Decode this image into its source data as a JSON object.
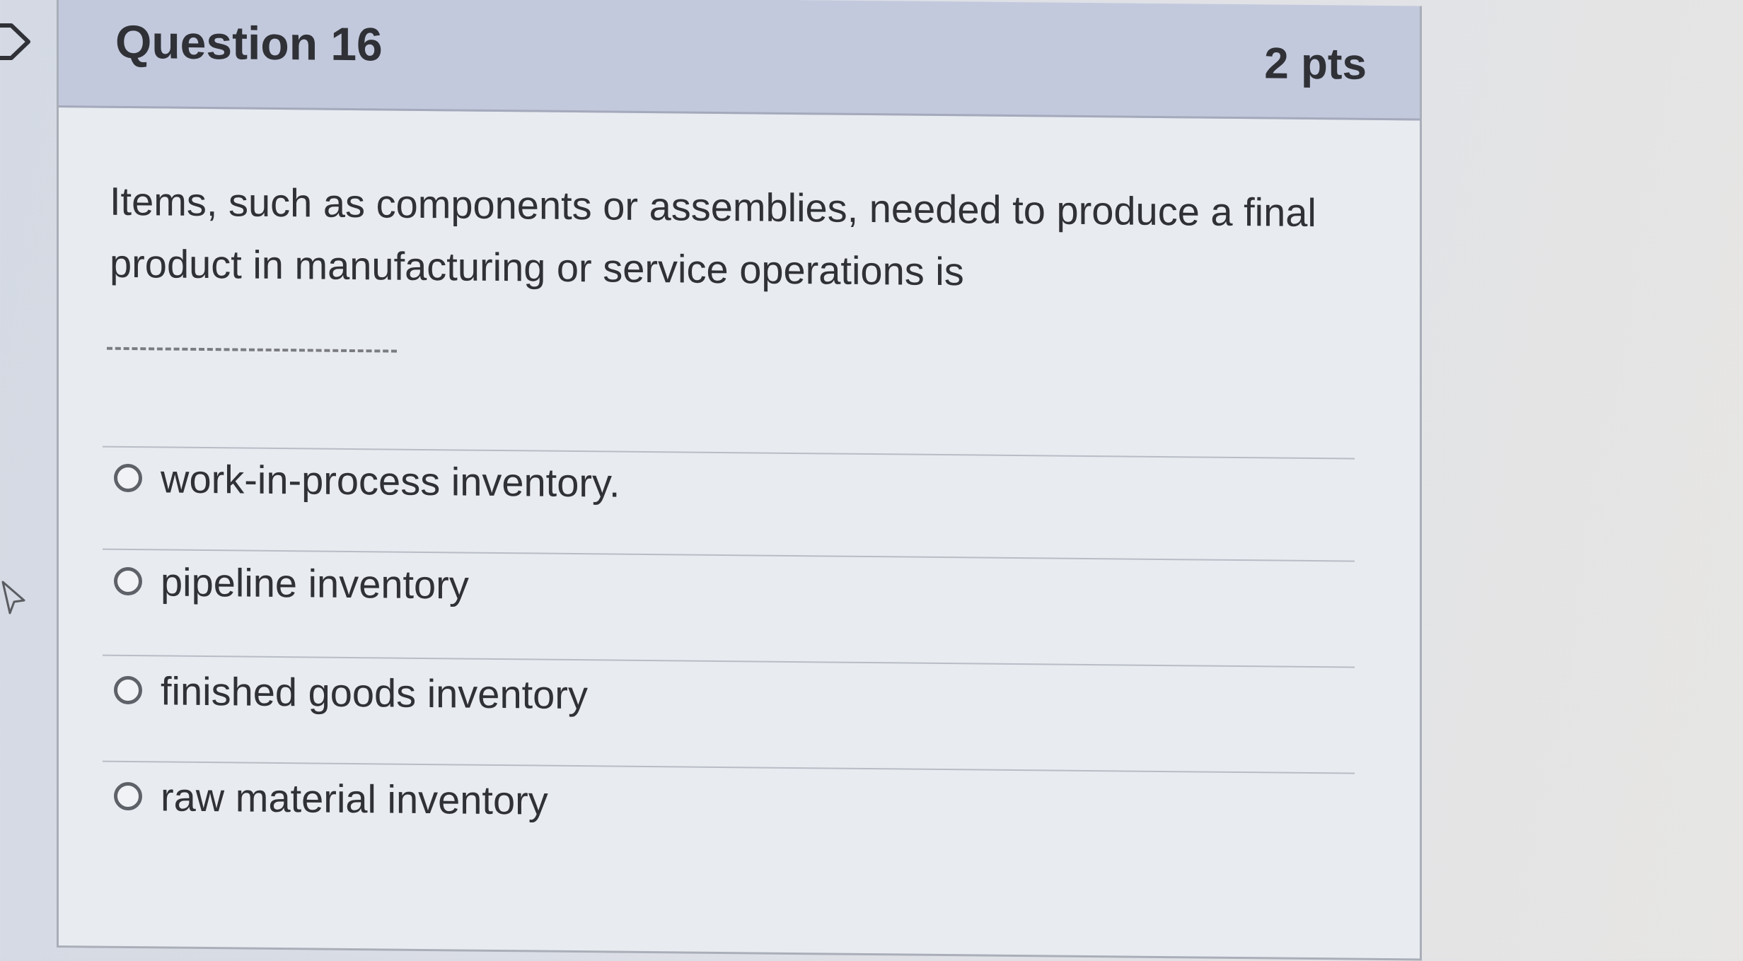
{
  "question": {
    "title": "Question 16",
    "points": "2 pts",
    "text": "Items, such as components or assemblies, needed to produce a final product in manufacturing or service operations is",
    "blank": "______________"
  },
  "answers": [
    {
      "label": "work-in-process inventory.",
      "selected": false
    },
    {
      "label": "pipeline inventory",
      "selected": false
    },
    {
      "label": "finished goods inventory",
      "selected": false
    },
    {
      "label": "raw material inventory",
      "selected": false
    }
  ],
  "colors": {
    "header_bg": "#c3c9dd",
    "card_bg": "#e8ebf0",
    "text": "#2f3136"
  },
  "icons": [
    "bookmark-icon",
    "cursor-icon",
    "radio-icon"
  ]
}
